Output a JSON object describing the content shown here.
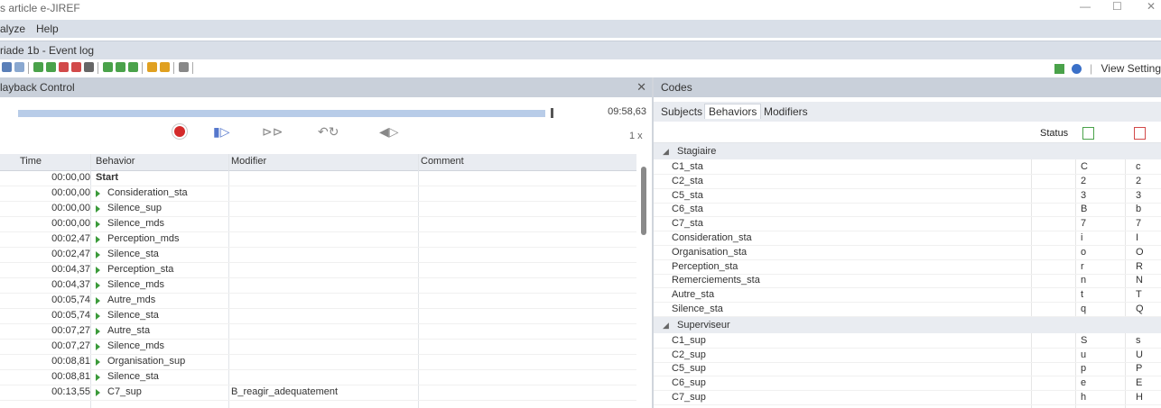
{
  "window": {
    "title": "s article e-JIREF",
    "controls": [
      "—",
      "☐",
      "✕"
    ]
  },
  "menu": [
    "alyze",
    "Help"
  ],
  "document_tab": "riade 1b - Event log",
  "toolbar": {
    "view_settings": "View Setting"
  },
  "playback": {
    "title": "layback Control",
    "close": "✕",
    "total_time": "09:58,63",
    "speed": "1 x",
    "progress": 0.99
  },
  "event_log": {
    "columns": [
      "Time",
      "Behavior",
      "Modifier",
      "Comment"
    ],
    "rows": [
      {
        "time": "00:00,00",
        "behavior": "Start",
        "modifier": "",
        "comment": ""
      },
      {
        "time": "00:00,00",
        "behavior": "Consideration_sta",
        "modifier": "",
        "comment": ""
      },
      {
        "time": "00:00,00",
        "behavior": "Silence_sup",
        "modifier": "",
        "comment": ""
      },
      {
        "time": "00:00,00",
        "behavior": "Silence_mds",
        "modifier": "",
        "comment": ""
      },
      {
        "time": "00:02,47",
        "behavior": "Perception_mds",
        "modifier": "",
        "comment": ""
      },
      {
        "time": "00:02,47",
        "behavior": "Silence_sta",
        "modifier": "",
        "comment": ""
      },
      {
        "time": "00:04,37",
        "behavior": "Perception_sta",
        "modifier": "",
        "comment": ""
      },
      {
        "time": "00:04,37",
        "behavior": "Silence_mds",
        "modifier": "",
        "comment": ""
      },
      {
        "time": "00:05,74",
        "behavior": "Autre_mds",
        "modifier": "",
        "comment": ""
      },
      {
        "time": "00:05,74",
        "behavior": "Silence_sta",
        "modifier": "",
        "comment": ""
      },
      {
        "time": "00:07,27",
        "behavior": "Autre_sta",
        "modifier": "",
        "comment": ""
      },
      {
        "time": "00:07,27",
        "behavior": "Silence_mds",
        "modifier": "",
        "comment": ""
      },
      {
        "time": "00:08,81",
        "behavior": "Organisation_sup",
        "modifier": "",
        "comment": ""
      },
      {
        "time": "00:08,81",
        "behavior": "Silence_sta",
        "modifier": "",
        "comment": ""
      },
      {
        "time": "00:13,55",
        "behavior": "C7_sup",
        "modifier": "B_reagir_adequatement",
        "comment": ""
      }
    ]
  },
  "codes": {
    "title": "Codes",
    "tabs": [
      "Subjects",
      "Behaviors",
      "Modifiers"
    ],
    "active_tab": "Behaviors",
    "status_label": "Status",
    "groups": [
      {
        "name": "Stagiaire",
        "items": [
          {
            "name": "C1_sta",
            "k1": "C",
            "k2": "c"
          },
          {
            "name": "C2_sta",
            "k1": "2",
            "k2": "2"
          },
          {
            "name": "C5_sta",
            "k1": "3",
            "k2": "3"
          },
          {
            "name": "C6_sta",
            "k1": "B",
            "k2": "b"
          },
          {
            "name": "C7_sta",
            "k1": "7",
            "k2": "7"
          },
          {
            "name": "Consideration_sta",
            "k1": "i",
            "k2": "I"
          },
          {
            "name": "Organisation_sta",
            "k1": "o",
            "k2": "O"
          },
          {
            "name": "Perception_sta",
            "k1": "r",
            "k2": "R"
          },
          {
            "name": "Remerciements_sta",
            "k1": "n",
            "k2": "N"
          },
          {
            "name": "Autre_sta",
            "k1": "t",
            "k2": "T"
          },
          {
            "name": "Silence_sta",
            "k1": "q",
            "k2": "Q"
          }
        ]
      },
      {
        "name": "Superviseur",
        "items": [
          {
            "name": "C1_sup",
            "k1": "S",
            "k2": "s"
          },
          {
            "name": "C2_sup",
            "k1": "u",
            "k2": "U"
          },
          {
            "name": "C5_sup",
            "k1": "p",
            "k2": "P"
          },
          {
            "name": "C6_sup",
            "k1": "e",
            "k2": "E"
          },
          {
            "name": "C7_sup",
            "k1": "h",
            "k2": "H"
          }
        ]
      }
    ]
  },
  "colors": {
    "accent": "#c9d0da",
    "progress": "#b8cce8",
    "record": "#d42a2a",
    "play_arrow": "#3a9a3a"
  }
}
